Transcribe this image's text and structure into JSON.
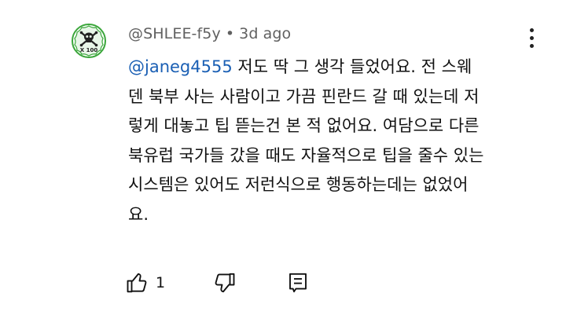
{
  "comment": {
    "author": "@SHLEE-f5y",
    "separator": "•",
    "time": "3d ago",
    "mention": "@janeg4555",
    "text": "  저도 딱 그 생각 들었어요. 전 스웨\n덴 북부 사는 사람이고 가끔 핀란드 갈 때 있는데 저\n렇게 대놓고 팁 뜯는건 본 적 없어요. 여담으로 다른\n북유럽 국가들 갔을 때도 자율적으로 팁을 줄수 있는\n시스템은 있어도 저런식으로 행동하는데는 없었어\n요.",
    "like_count": "1",
    "avatar_text": "X 100"
  },
  "icons": {
    "avatar": "skull-crossbones-avatar-icon",
    "more": "more-vert-icon",
    "like": "thumb-up-icon",
    "dislike": "thumb-down-icon",
    "reply": "reply-comment-icon"
  },
  "colors": {
    "mention": "#1a5fb4",
    "meta": "#606060",
    "avatar_green": "#3aa63a"
  }
}
